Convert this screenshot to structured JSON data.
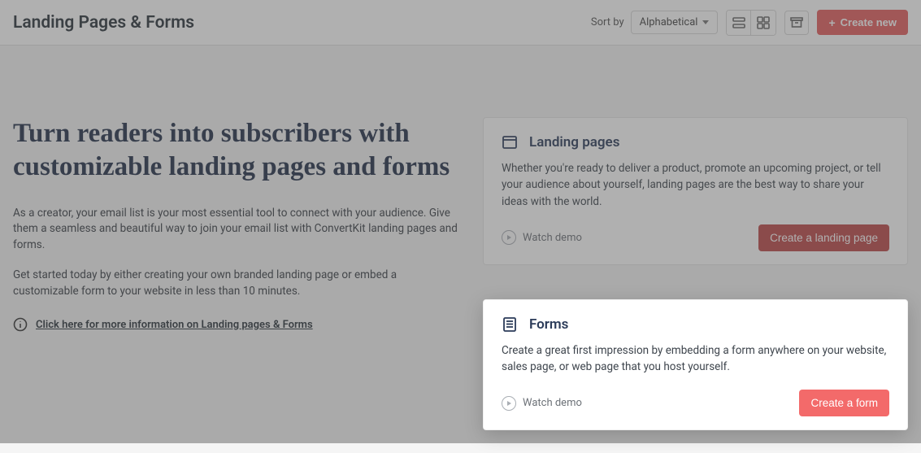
{
  "topbar": {
    "title": "Landing Pages & Forms",
    "sort_label": "Sort by",
    "sort_value": "Alphabetical",
    "create_new_label": "Create new"
  },
  "hero": {
    "headline": "Turn readers into subscribers with customizable landing pages and forms",
    "p1": "As a creator, your email list is your most essential tool to connect with your audience. Give them a seamless and beautiful way to join your email list with ConvertKit landing pages and forms.",
    "p2": "Get started today by either creating your own branded landing page or embed a customizable form to your website in less than 10 minutes.",
    "info_link": "Click here for more information on Landing pages & Forms"
  },
  "cards": {
    "landing": {
      "title": "Landing pages",
      "desc": "Whether you're ready to deliver a product, promote an upcoming project, or tell your audience about yourself, landing pages are the best way to share your ideas with the world.",
      "watch_label": "Watch demo",
      "cta_label": "Create a landing page"
    },
    "forms": {
      "title": "Forms",
      "desc": "Create a great first impression by embedding a form anywhere on your website, sales page, or web page that you host yourself.",
      "watch_label": "Watch demo",
      "cta_label": "Create a form"
    }
  }
}
